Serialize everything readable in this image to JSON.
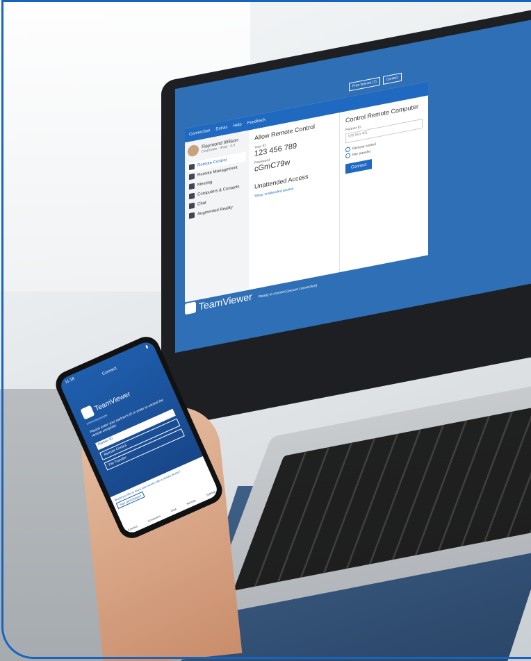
{
  "laptop": {
    "window_menu": [
      "Connection",
      "Extras",
      "Help",
      "Feedback"
    ],
    "top_buttons": [
      "Free license (?)",
      "Contact"
    ],
    "user": {
      "name": "Raymond Wilson",
      "subtitle": "Corporate · iPad · 4.0"
    },
    "nav": [
      {
        "label": "Remote Control",
        "icon": "arrows-icon",
        "active": true
      },
      {
        "label": "Remote Management",
        "icon": "network-icon",
        "active": false
      },
      {
        "label": "Meeting",
        "icon": "people-icon",
        "active": false
      },
      {
        "label": "Computers & Contacts",
        "icon": "contacts-icon",
        "active": false
      },
      {
        "label": "Chat",
        "icon": "chat-icon",
        "active": false
      },
      {
        "label": "Augmented Reality",
        "icon": "ar-icon",
        "active": false
      }
    ],
    "allow": {
      "heading": "Allow Remote Control",
      "id_label": "Your ID",
      "id": "123 456 789",
      "password_label": "Password",
      "password": "cGmC79w",
      "unattended_heading": "Unattended Access",
      "unattended_link": "Setup unattended access"
    },
    "control": {
      "heading": "Control Remote Computer",
      "partner_label": "Partner ID",
      "partner_value": "978 563 451",
      "options": [
        "Remote control",
        "File transfer"
      ],
      "connect_label": "Connect"
    },
    "status": "Ready to connect (secure connection)",
    "brand": "TeamViewer"
  },
  "phone": {
    "time": "11:18",
    "title": "Connect",
    "brand": "TeamViewer",
    "tagline": "connecting people",
    "instruction": "Please enter your partner's ID in order to control the remote computer.",
    "partner_placeholder": "Partner ID",
    "remote_control": "Remote Control",
    "file_transfer": "File Transfer",
    "bottom_text": "Would you like to share your screen with a remote device?",
    "bottom_button": "Start QuickSupport",
    "tabs": [
      "Connect",
      "Computers",
      "Chat",
      "Remote",
      "Settings"
    ]
  }
}
